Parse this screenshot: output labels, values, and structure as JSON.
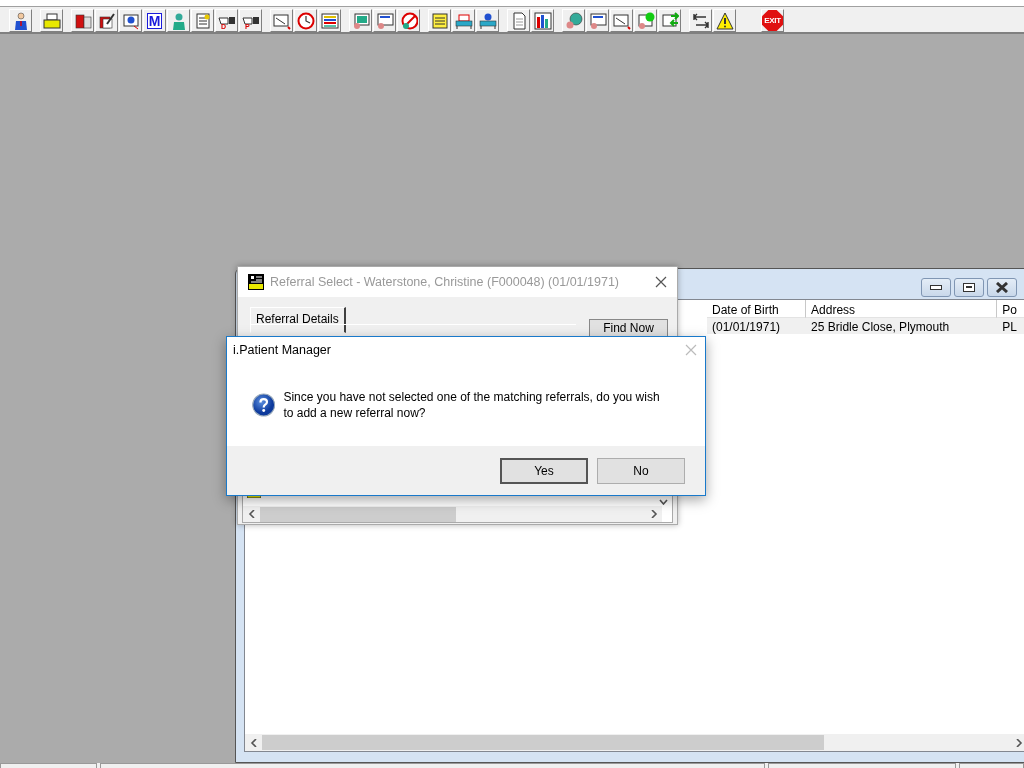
{
  "toolbar": {
    "glyphs": [
      "M",
      "D",
      "P",
      "EXIT"
    ]
  },
  "patient_list_window": {
    "columns": [
      "Date of Birth",
      "Address",
      "Po"
    ],
    "rows": [
      [
        "(01/01/1971)",
        "25 Bridle Close, Plymouth",
        "PL"
      ]
    ]
  },
  "referral_window": {
    "title": "Referral Select - Waterstone, Christine (F000048) (01/01/1971)",
    "tabs": [
      {
        "label": "Referral Details",
        "selected": true
      }
    ],
    "buttons": [
      "Find Now"
    ]
  },
  "dialog": {
    "title": "i.Patient Manager",
    "message": "Since you have not selected one of the matching referrals, do you wish to add a new referral now?",
    "buttons": [
      {
        "label": "Yes",
        "default": true
      },
      {
        "label": "No",
        "default": false
      }
    ]
  }
}
